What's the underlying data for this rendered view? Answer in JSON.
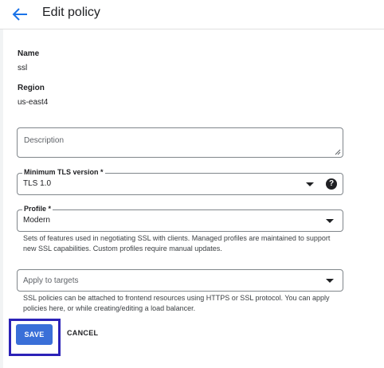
{
  "header": {
    "title": "Edit policy",
    "back_icon": "arrow-back-icon",
    "accent_color": "#1a73e8"
  },
  "details": {
    "name_label": "Name",
    "name_value": "ssl",
    "region_label": "Region",
    "region_value": "us-east4"
  },
  "form": {
    "description": {
      "placeholder": "Description",
      "value": ""
    },
    "min_tls": {
      "label": "Minimum TLS version *",
      "value": "TLS 1.0",
      "help_icon": "help-icon"
    },
    "profile": {
      "label": "Profile *",
      "value": "Modern",
      "hint": "Sets of features used in negotiating SSL with clients. Managed profiles are maintained to support new SSL capabilities. Custom profiles require manual updates."
    },
    "targets": {
      "placeholder": "Apply to targets",
      "hint": "SSL policies can be attached to frontend resources using HTTPS or SSL protocol. You can apply policies here, or while creating/editing a load balancer."
    }
  },
  "actions": {
    "save_label": "SAVE",
    "cancel_label": "CANCEL",
    "save_color": "#3a6fd8",
    "highlight_color": "#2c22b8"
  }
}
